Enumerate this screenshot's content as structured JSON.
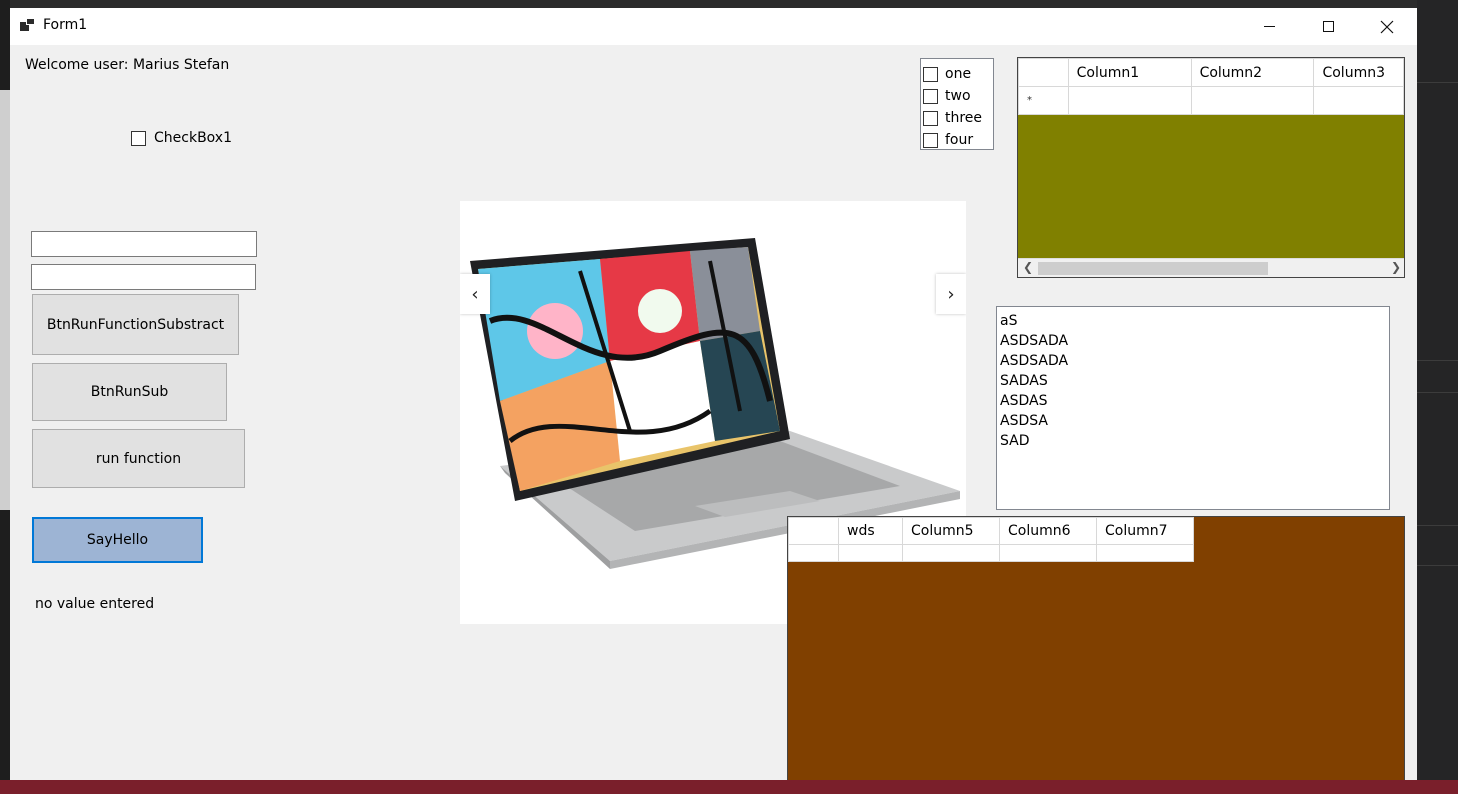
{
  "window": {
    "title": "Form1"
  },
  "labels": {
    "welcome": "Welcome user: Marius Stefan",
    "status": "no value entered"
  },
  "checkbox1": {
    "label": "CheckBox1"
  },
  "textboxes": [
    {
      "value": ""
    },
    {
      "value": ""
    }
  ],
  "buttons": {
    "subtract": "BtnRunFunctionSubstract",
    "run_sub": "BtnRunSub",
    "run_function": "run function",
    "say_hello": "SayHello"
  },
  "checked_list": [
    {
      "label": "one",
      "checked": false
    },
    {
      "label": "two",
      "checked": false
    },
    {
      "label": "three",
      "checked": false
    },
    {
      "label": "four",
      "checked": false
    }
  ],
  "image_carousel": {
    "prev": "‹",
    "next": "›"
  },
  "grid1": {
    "columns": [
      "",
      "Column1",
      "Column2",
      "Column3"
    ],
    "new_row_marker": "*",
    "background": "#808000"
  },
  "listbox": {
    "items": [
      "aS",
      "ASDSADA",
      "ASDSADA",
      "SADAS",
      "ASDAS",
      "ASDSA",
      "SAD"
    ]
  },
  "grid2": {
    "columns": [
      "",
      "wds",
      "Column5",
      "Column6",
      "Column7"
    ],
    "background": "#804000"
  }
}
